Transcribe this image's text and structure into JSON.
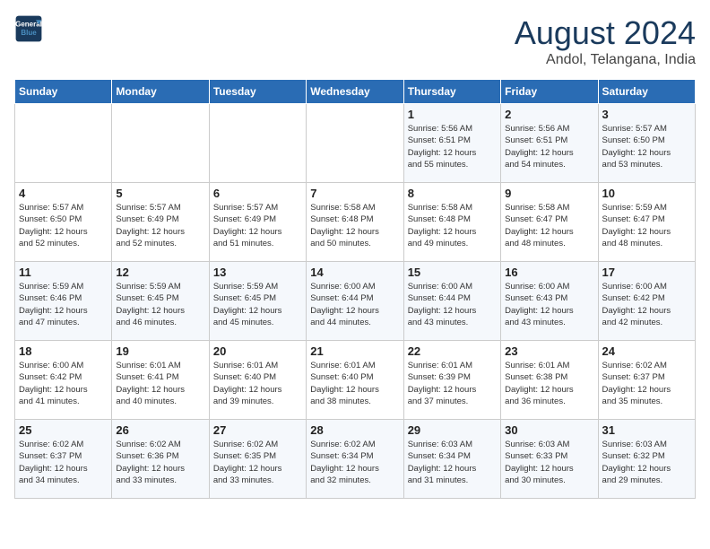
{
  "logo": {
    "line1": "General",
    "line2": "Blue"
  },
  "title": "August 2024",
  "subtitle": "Andol, Telangana, India",
  "days_of_week": [
    "Sunday",
    "Monday",
    "Tuesday",
    "Wednesday",
    "Thursday",
    "Friday",
    "Saturday"
  ],
  "weeks": [
    [
      {
        "day": "",
        "detail": ""
      },
      {
        "day": "",
        "detail": ""
      },
      {
        "day": "",
        "detail": ""
      },
      {
        "day": "",
        "detail": ""
      },
      {
        "day": "1",
        "detail": "Sunrise: 5:56 AM\nSunset: 6:51 PM\nDaylight: 12 hours\nand 55 minutes."
      },
      {
        "day": "2",
        "detail": "Sunrise: 5:56 AM\nSunset: 6:51 PM\nDaylight: 12 hours\nand 54 minutes."
      },
      {
        "day": "3",
        "detail": "Sunrise: 5:57 AM\nSunset: 6:50 PM\nDaylight: 12 hours\nand 53 minutes."
      }
    ],
    [
      {
        "day": "4",
        "detail": "Sunrise: 5:57 AM\nSunset: 6:50 PM\nDaylight: 12 hours\nand 52 minutes."
      },
      {
        "day": "5",
        "detail": "Sunrise: 5:57 AM\nSunset: 6:49 PM\nDaylight: 12 hours\nand 52 minutes."
      },
      {
        "day": "6",
        "detail": "Sunrise: 5:57 AM\nSunset: 6:49 PM\nDaylight: 12 hours\nand 51 minutes."
      },
      {
        "day": "7",
        "detail": "Sunrise: 5:58 AM\nSunset: 6:48 PM\nDaylight: 12 hours\nand 50 minutes."
      },
      {
        "day": "8",
        "detail": "Sunrise: 5:58 AM\nSunset: 6:48 PM\nDaylight: 12 hours\nand 49 minutes."
      },
      {
        "day": "9",
        "detail": "Sunrise: 5:58 AM\nSunset: 6:47 PM\nDaylight: 12 hours\nand 48 minutes."
      },
      {
        "day": "10",
        "detail": "Sunrise: 5:59 AM\nSunset: 6:47 PM\nDaylight: 12 hours\nand 48 minutes."
      }
    ],
    [
      {
        "day": "11",
        "detail": "Sunrise: 5:59 AM\nSunset: 6:46 PM\nDaylight: 12 hours\nand 47 minutes."
      },
      {
        "day": "12",
        "detail": "Sunrise: 5:59 AM\nSunset: 6:45 PM\nDaylight: 12 hours\nand 46 minutes."
      },
      {
        "day": "13",
        "detail": "Sunrise: 5:59 AM\nSunset: 6:45 PM\nDaylight: 12 hours\nand 45 minutes."
      },
      {
        "day": "14",
        "detail": "Sunrise: 6:00 AM\nSunset: 6:44 PM\nDaylight: 12 hours\nand 44 minutes."
      },
      {
        "day": "15",
        "detail": "Sunrise: 6:00 AM\nSunset: 6:44 PM\nDaylight: 12 hours\nand 43 minutes."
      },
      {
        "day": "16",
        "detail": "Sunrise: 6:00 AM\nSunset: 6:43 PM\nDaylight: 12 hours\nand 43 minutes."
      },
      {
        "day": "17",
        "detail": "Sunrise: 6:00 AM\nSunset: 6:42 PM\nDaylight: 12 hours\nand 42 minutes."
      }
    ],
    [
      {
        "day": "18",
        "detail": "Sunrise: 6:00 AM\nSunset: 6:42 PM\nDaylight: 12 hours\nand 41 minutes."
      },
      {
        "day": "19",
        "detail": "Sunrise: 6:01 AM\nSunset: 6:41 PM\nDaylight: 12 hours\nand 40 minutes."
      },
      {
        "day": "20",
        "detail": "Sunrise: 6:01 AM\nSunset: 6:40 PM\nDaylight: 12 hours\nand 39 minutes."
      },
      {
        "day": "21",
        "detail": "Sunrise: 6:01 AM\nSunset: 6:40 PM\nDaylight: 12 hours\nand 38 minutes."
      },
      {
        "day": "22",
        "detail": "Sunrise: 6:01 AM\nSunset: 6:39 PM\nDaylight: 12 hours\nand 37 minutes."
      },
      {
        "day": "23",
        "detail": "Sunrise: 6:01 AM\nSunset: 6:38 PM\nDaylight: 12 hours\nand 36 minutes."
      },
      {
        "day": "24",
        "detail": "Sunrise: 6:02 AM\nSunset: 6:37 PM\nDaylight: 12 hours\nand 35 minutes."
      }
    ],
    [
      {
        "day": "25",
        "detail": "Sunrise: 6:02 AM\nSunset: 6:37 PM\nDaylight: 12 hours\nand 34 minutes."
      },
      {
        "day": "26",
        "detail": "Sunrise: 6:02 AM\nSunset: 6:36 PM\nDaylight: 12 hours\nand 33 minutes."
      },
      {
        "day": "27",
        "detail": "Sunrise: 6:02 AM\nSunset: 6:35 PM\nDaylight: 12 hours\nand 33 minutes."
      },
      {
        "day": "28",
        "detail": "Sunrise: 6:02 AM\nSunset: 6:34 PM\nDaylight: 12 hours\nand 32 minutes."
      },
      {
        "day": "29",
        "detail": "Sunrise: 6:03 AM\nSunset: 6:34 PM\nDaylight: 12 hours\nand 31 minutes."
      },
      {
        "day": "30",
        "detail": "Sunrise: 6:03 AM\nSunset: 6:33 PM\nDaylight: 12 hours\nand 30 minutes."
      },
      {
        "day": "31",
        "detail": "Sunrise: 6:03 AM\nSunset: 6:32 PM\nDaylight: 12 hours\nand 29 minutes."
      }
    ]
  ]
}
